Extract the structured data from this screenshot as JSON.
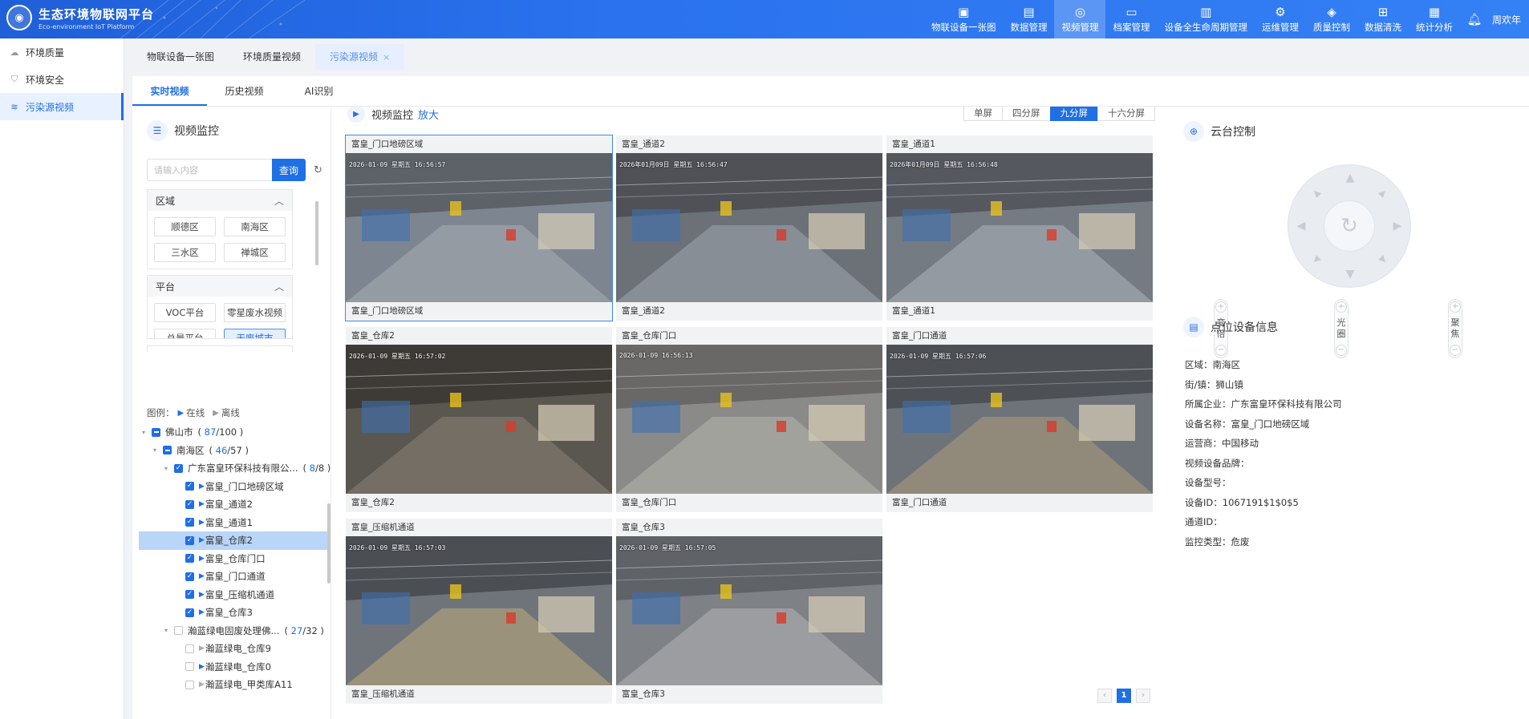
{
  "header": {
    "title": "生态环境物联网平台",
    "subtitle": "Eco-environment IoT Platform",
    "nav": [
      {
        "label": "物联设备一张图",
        "icon": "image-icon"
      },
      {
        "label": "数据管理",
        "icon": "database-icon"
      },
      {
        "label": "视频管理",
        "icon": "video-ai-icon",
        "active": true
      },
      {
        "label": "档案管理",
        "icon": "folder-icon"
      },
      {
        "label": "设备全生命周期管理",
        "icon": "device-lifecycle-icon"
      },
      {
        "label": "运维管理",
        "icon": "maintenance-icon"
      },
      {
        "label": "质量控制",
        "icon": "quality-icon"
      },
      {
        "label": "数据清洗",
        "icon": "data-clean-icon"
      },
      {
        "label": "统计分析",
        "icon": "chart-icon"
      }
    ],
    "user": "周欢年"
  },
  "sidebar": {
    "items": [
      {
        "label": "环境质量"
      },
      {
        "label": "环境安全"
      },
      {
        "label": "污染源视频"
      }
    ]
  },
  "page_tabs": [
    {
      "label": "物联设备一张图"
    },
    {
      "label": "环境质量视频"
    },
    {
      "label": "污染源视频",
      "close": "×"
    }
  ],
  "sub_tabs": [
    {
      "label": "实时视频"
    },
    {
      "label": "历史视频"
    },
    {
      "label": "AI识别"
    }
  ],
  "monitor": {
    "title": "视频监控",
    "search_placeholder": "请输入内容",
    "search_value": "",
    "query_label": "查询",
    "region_title": "区域",
    "regions": [
      "顺德区",
      "南海区",
      "三水区",
      "禅城区"
    ],
    "platform_title": "平台",
    "platforms": [
      "VOC平台",
      "零星废水视频",
      "总量平台",
      "无废城市"
    ],
    "legend_label": "图例：",
    "legend_online": "在线",
    "legend_offline": "离线"
  },
  "tree": [
    {
      "label": "佛山市",
      "level": 0,
      "a": "87",
      "b": "/100",
      "check": "half",
      "arrow": "▾"
    },
    {
      "label": "南海区",
      "level": 1,
      "a": "46",
      "b": "/57",
      "check": "half",
      "arrow": "▾"
    },
    {
      "label": "广东富皇环保科技有限公...",
      "level": 2,
      "a": "8",
      "b": "/8",
      "check": "on",
      "arrow": "▾"
    },
    {
      "label": "富皇_门口地磅区域",
      "level": 3,
      "check": "on",
      "cam": "on"
    },
    {
      "label": "富皇_通道2",
      "level": 3,
      "check": "on",
      "cam": "on"
    },
    {
      "label": "富皇_通道1",
      "level": 3,
      "check": "on",
      "cam": "on"
    },
    {
      "label": "富皇_仓库2",
      "level": 3,
      "check": "on",
      "cam": "on",
      "sel": true
    },
    {
      "label": "富皇_仓库门口",
      "level": 3,
      "check": "on",
      "cam": "on"
    },
    {
      "label": "富皇_门口通道",
      "level": 3,
      "check": "on",
      "cam": "on"
    },
    {
      "label": "富皇_压缩机通道",
      "level": 3,
      "check": "on",
      "cam": "on"
    },
    {
      "label": "富皇_仓库3",
      "level": 3,
      "check": "on",
      "cam": "on"
    },
    {
      "label": "瀚蓝绿电固废处理佛...",
      "level": 2,
      "a": "27",
      "b": "/32",
      "check": "off",
      "arrow": "▾"
    },
    {
      "label": "瀚蓝绿电_仓库9",
      "level": 3,
      "check": "off",
      "cam": "off"
    },
    {
      "label": "瀚蓝绿电_仓库0",
      "level": 3,
      "check": "off",
      "cam": "on"
    },
    {
      "label": "瀚蓝绿电_甲类库A11",
      "level": 3,
      "check": "off",
      "cam": "off"
    }
  ],
  "video": {
    "title": "视频监控",
    "zoom_label": "放大",
    "layouts": [
      "单屏",
      "四分屏",
      "九分屏",
      "十六分屏"
    ],
    "active_layout": "九分屏",
    "cells": [
      {
        "name": "富皇_门口地磅区域",
        "osd": "2026-01-09 星期五 16:56:57"
      },
      {
        "name": "富皇_通道2",
        "osd": "2026年01月09日 星期五 16:56:47"
      },
      {
        "name": "富皇_通道1",
        "osd": "2026年01月09日 星期五 16:56:48"
      },
      {
        "name": "富皇_仓库2",
        "osd": "2026-01-09 星期五 16:57:02"
      },
      {
        "name": "富皇_仓库门口",
        "osd": "2026-01-09 16:56:13"
      },
      {
        "name": "富皇_门口通道",
        "osd": "2026-01-09 星期五 16:57:06"
      },
      {
        "name": "富皇_压缩机通道",
        "osd": "2026-01-09 星期五 16:57:03"
      },
      {
        "name": "富皇_仓库3",
        "osd": "2026-01-09 星期五 16:57:05"
      }
    ],
    "pager": {
      "prev": "‹",
      "current": "1",
      "next": "›"
    }
  },
  "ptz": {
    "title": "云台控制",
    "sliders": [
      {
        "label": "变倍"
      },
      {
        "label": "光圈"
      },
      {
        "label": "聚焦"
      }
    ]
  },
  "device": {
    "title": "点位设备信息",
    "fields": [
      "区域：南海区",
      "街/镇：狮山镇",
      "所属企业：广东富皇环保科技有限公司",
      "设备名称：富皇_门口地磅区域",
      "运营商：中国移动",
      "视频设备品牌：",
      "设备型号：",
      "设备ID：1067191$1$0$5",
      "通道ID：",
      "监控类型：危废"
    ]
  },
  "colors": {
    "primary": "#1f6fe5",
    "topbar": "#2a72ee",
    "selected_row": "#b9d5f7"
  }
}
